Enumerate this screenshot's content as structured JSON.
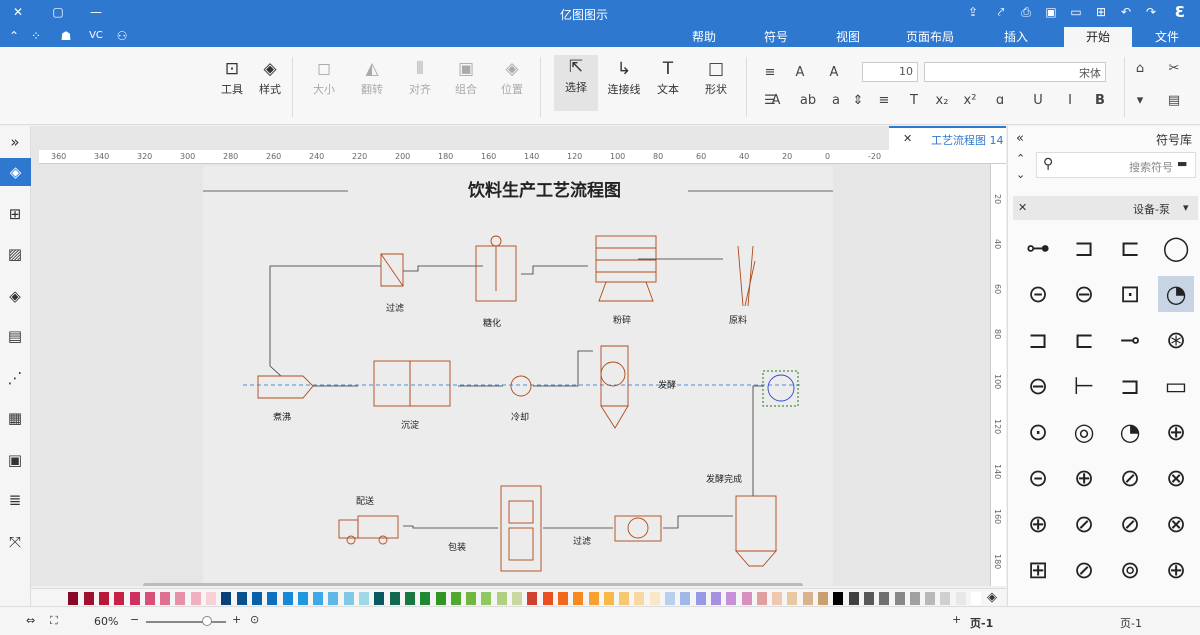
{
  "app": {
    "title": "亿图图示"
  },
  "menu": {
    "tabs": [
      "文件",
      "开始",
      "插入",
      "页面布局",
      "视图",
      "符号",
      "帮助"
    ],
    "active": "开始"
  },
  "titlebar": {
    "vc_label": "VC"
  },
  "ribbon": {
    "font_name": "宋体",
    "font_size": "10",
    "buttons": {
      "select": "选择",
      "connector": "连接线",
      "text": "文本",
      "shape": "形状",
      "style": "样式",
      "tools": "工具",
      "size": "大小",
      "rotate": "翻转",
      "align": "对齐",
      "group": "组合",
      "position": "位置"
    }
  },
  "document": {
    "tab_label": "工艺流程图 14",
    "title": "饮料生产工艺流程图",
    "ruler_h": [
      "360",
      "340",
      "320",
      "300",
      "280",
      "260",
      "240",
      "220",
      "200",
      "180",
      "160",
      "140",
      "120",
      "100",
      "80",
      "60",
      "40",
      "20",
      "0",
      "-20"
    ],
    "ruler_v": [
      "20",
      "40",
      "60",
      "80",
      "100",
      "120",
      "140",
      "160",
      "180"
    ],
    "labels": {
      "raw": "原料",
      "grind": "粉碎",
      "saccharify": "糖化",
      "filter1": "过滤",
      "ferment": "发酵",
      "cool": "冷却",
      "settle": "沉淀",
      "boil": "煮沸",
      "ferment_done": "发酵完成",
      "filter2": "过滤",
      "package": "包装",
      "deliver": "配送"
    }
  },
  "library": {
    "title": "符号库",
    "search_placeholder": "搜索符号",
    "category": "设备-泵"
  },
  "status": {
    "page_left": "页-1",
    "page_right": "页-1",
    "zoom": "60%"
  },
  "colors": {
    "accent": "#2f78d0",
    "diagram_line": "#b04a1a",
    "palette": [
      "#ffffff",
      "#e8e8e8",
      "#d0d0d0",
      "#b8b8b8",
      "#a0a0a0",
      "#888888",
      "#707070",
      "#585858",
      "#404040",
      "#000000",
      "#c8a070",
      "#d9b38c",
      "#e8c8a0",
      "#f0c8b0",
      "#e0a0a0",
      "#d890c0",
      "#c890d8",
      "#a890e0",
      "#9898e8",
      "#a0b8e8",
      "#b8d0f0",
      "#f8e8c8",
      "#f8d8a0",
      "#f8c870",
      "#f8b848",
      "#f8a030",
      "#f88820",
      "#f06818",
      "#e85020",
      "#d04030",
      "#c8d8a0",
      "#b0d080",
      "#90c860",
      "#70b840",
      "#50a830",
      "#309820",
      "#208830",
      "#187840",
      "#106850",
      "#0c5860",
      "#a0d8e8",
      "#80c8e8",
      "#60b8e8",
      "#40a8e8",
      "#2098e0",
      "#1888d8",
      "#1070c0",
      "#0860a8",
      "#085090",
      "#084078",
      "#f8d0d8",
      "#f0b0c0",
      "#e890a8",
      "#e07090",
      "#d85078",
      "#d03060",
      "#c82048",
      "#b81838",
      "#a01030",
      "#880828"
    ]
  }
}
